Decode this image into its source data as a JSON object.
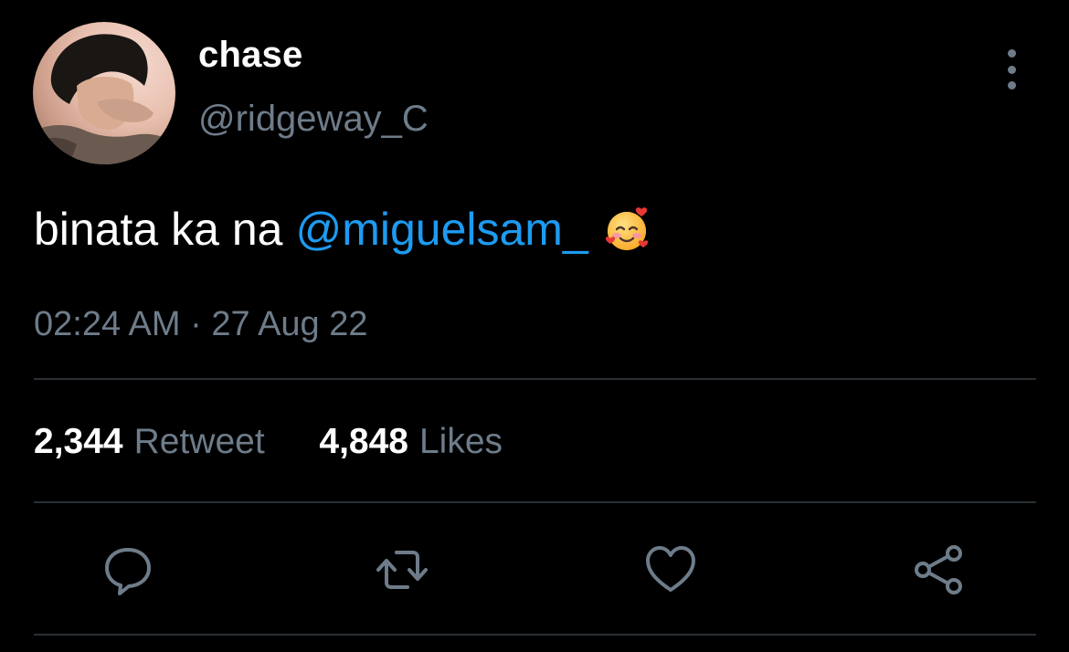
{
  "user": {
    "display_name": "chase",
    "handle": "@ridgeway_C",
    "avatar": "profile-photo"
  },
  "tweet": {
    "text": "binata ka na",
    "mention": "@miguelsam_",
    "emoji": "smiling-face-with-hearts"
  },
  "meta": {
    "time": "02:24 AM",
    "separator": "·",
    "date": "27 Aug 22"
  },
  "stats": {
    "retweets_count": "2,344",
    "retweets_label": "Retweet",
    "likes_count": "4,848",
    "likes_label": "Likes"
  },
  "actions": [
    {
      "icon": "reply-icon"
    },
    {
      "icon": "retweet-icon"
    },
    {
      "icon": "like-icon"
    },
    {
      "icon": "share-icon"
    }
  ],
  "colors": {
    "background": "#000000",
    "primary_text": "#ffffff",
    "secondary_text": "#6e7c8a",
    "mention": "#1d9bf0",
    "divider": "#2a2f34"
  }
}
